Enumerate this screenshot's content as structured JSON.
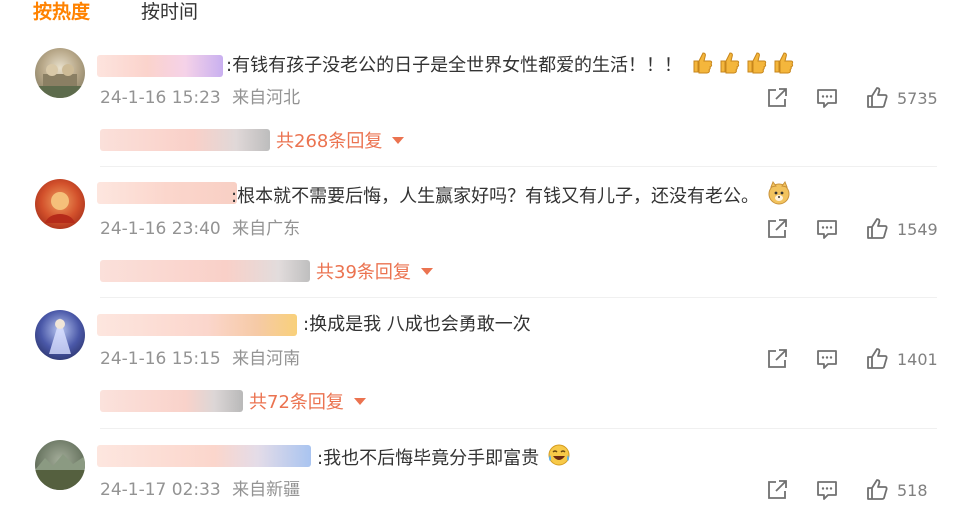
{
  "tabs": {
    "hot": "按热度",
    "time": "按时间"
  },
  "comments": [
    {
      "text": ":有钱有孩子没老公的日子是全世界女性都爱的生活！！！",
      "emoji": [
        "thumbs-up-emoji",
        "thumbs-up-emoji",
        "thumbs-up-emoji",
        "thumbs-up-emoji"
      ],
      "time": "24-1-16 15:23",
      "location": "来自河北",
      "likes": "5735",
      "replies": "共268条回复"
    },
    {
      "text": ":根本就不需要后悔，人生赢家好吗？有钱又有儿子，还没有老公。",
      "emoji": [
        "doge-emoji"
      ],
      "time": "24-1-16 23:40",
      "location": "来自广东",
      "likes": "1549",
      "replies": "共39条回复"
    },
    {
      "text": ":换成是我 八成也会勇敢一次",
      "emoji": [],
      "time": "24-1-16 15:15",
      "location": "来自河南",
      "likes": "1401",
      "replies": "共72条回复"
    },
    {
      "text": ":我也不后悔毕竟分手即富贵",
      "emoji": [
        "laughing-tears-emoji"
      ],
      "time": "24-1-17 02:33",
      "location": "来自新疆",
      "likes": "518"
    }
  ],
  "colors": {
    "accent": "#ff8200",
    "reply": "#eb7350",
    "meta": "#939393"
  }
}
